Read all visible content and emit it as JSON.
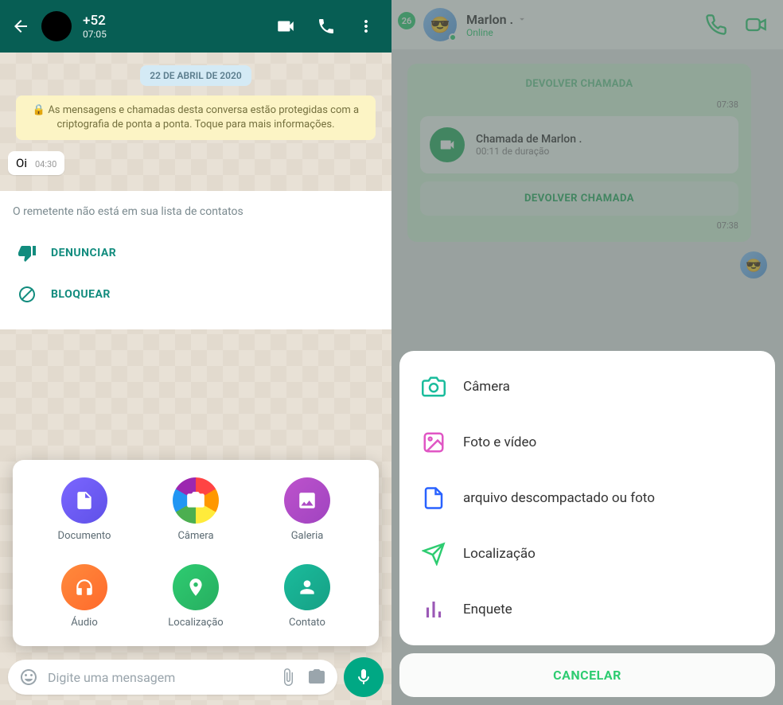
{
  "left": {
    "header": {
      "phone": "+52",
      "time": "07:05"
    },
    "date_label": "22 DE ABRIL DE 2020",
    "encryption": "🔒 As mensagens e chamadas desta conversa estão protegidas com a criptografia de ponta a ponta. Toque para mais informações.",
    "message": {
      "text": "Oi",
      "time": "04:30"
    },
    "unknown_sender": {
      "note": "O remetente não está em sua lista de contatos",
      "actions": {
        "report": "DENUNCIAR",
        "block": "BLOQUEAR"
      }
    },
    "attachments": {
      "document": "Documento",
      "camera": "Câmera",
      "gallery": "Galeria",
      "audio": "Áudio",
      "location": "Localização",
      "contact": "Contato"
    },
    "input_placeholder": "Digite uma mensagem"
  },
  "right": {
    "header": {
      "badge": "26",
      "name": "Marlon .",
      "status": "Online"
    },
    "call_bubble": {
      "prev_btn": "DEVOLVER CHAMADA",
      "prev_time": "07:38",
      "title": "Chamada de Marlon .",
      "duration": "00:11 de duração",
      "return_btn": "DEVOLVER CHAMADA",
      "time": "07:38"
    },
    "sheet": {
      "items": [
        {
          "label": "Câmera"
        },
        {
          "label": "Foto e vídeo"
        },
        {
          "label": "arquivo descompactado ou foto"
        },
        {
          "label": "Localização"
        },
        {
          "label": "Enquete"
        }
      ],
      "cancel": "CANCELAR"
    }
  }
}
